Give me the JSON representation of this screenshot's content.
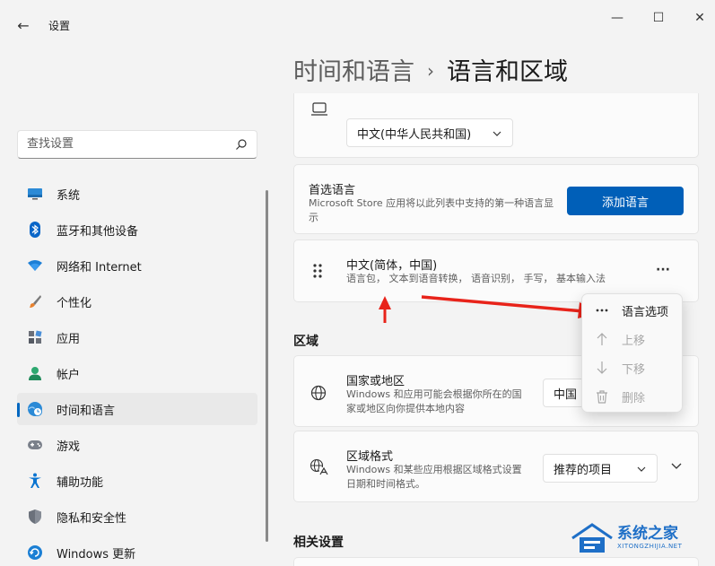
{
  "window": {
    "title": "设置",
    "back_glyph": "←",
    "minimize_glyph": "—",
    "maximize_glyph": "☐",
    "close_glyph": "✕"
  },
  "search": {
    "placeholder": "查找设置"
  },
  "sidebar": {
    "items": [
      {
        "label": "系统",
        "icon": "monitor-icon",
        "active": false
      },
      {
        "label": "蓝牙和其他设备",
        "icon": "bluetooth-icon",
        "active": false
      },
      {
        "label": "网络和 Internet",
        "icon": "wifi-icon",
        "active": false
      },
      {
        "label": "个性化",
        "icon": "brush-icon",
        "active": false
      },
      {
        "label": "应用",
        "icon": "apps-icon",
        "active": false
      },
      {
        "label": "帐户",
        "icon": "person-icon",
        "active": false
      },
      {
        "label": "时间和语言",
        "icon": "clock-globe-icon",
        "active": true
      },
      {
        "label": "游戏",
        "icon": "gamepad-icon",
        "active": false
      },
      {
        "label": "辅助功能",
        "icon": "accessibility-icon",
        "active": false
      },
      {
        "label": "隐私和安全性",
        "icon": "shield-icon",
        "active": false
      },
      {
        "label": "Windows 更新",
        "icon": "update-icon",
        "active": false
      }
    ]
  },
  "breadcrumb": {
    "parent": "时间和语言",
    "separator": "›",
    "current": "语言和区域"
  },
  "display_language": {
    "dropdown_value": "中文(中华人民共和国)"
  },
  "preferred_languages": {
    "title": "首选语言",
    "description": "Microsoft Store 应用将以此列表中支持的第一种语言显示",
    "add_button": "添加语言"
  },
  "language_item": {
    "name": "中文(简体，中国)",
    "features": "语言包， 文本到语音转换， 语音识别， 手写， 基本输入法",
    "more_glyph": "···"
  },
  "context_menu": {
    "items": [
      {
        "label": "语言选项",
        "icon": "more-icon",
        "disabled": false
      },
      {
        "label": "上移",
        "icon": "arrow-up-icon",
        "disabled": true
      },
      {
        "label": "下移",
        "icon": "arrow-down-icon",
        "disabled": true
      },
      {
        "label": "删除",
        "icon": "trash-icon",
        "disabled": true
      }
    ]
  },
  "region_section": {
    "title": "区域",
    "country": {
      "title": "国家或地区",
      "description": "Windows 和应用可能会根据你所在的国家或地区向你提供本地内容",
      "value": "中国"
    },
    "format": {
      "title": "区域格式",
      "description": "Windows 和某些应用根据区域格式设置日期和时间格式。",
      "value": "推荐的项目"
    }
  },
  "related_section": {
    "title": "相关设置"
  },
  "watermark": {
    "title": "系统之家",
    "subtitle": "XITONGZHIJIA.NET"
  },
  "colors": {
    "accent": "#005fb8",
    "annotation_arrow": "#e8231a",
    "background": "#f3f3f3",
    "card": "#fbfbfb"
  }
}
